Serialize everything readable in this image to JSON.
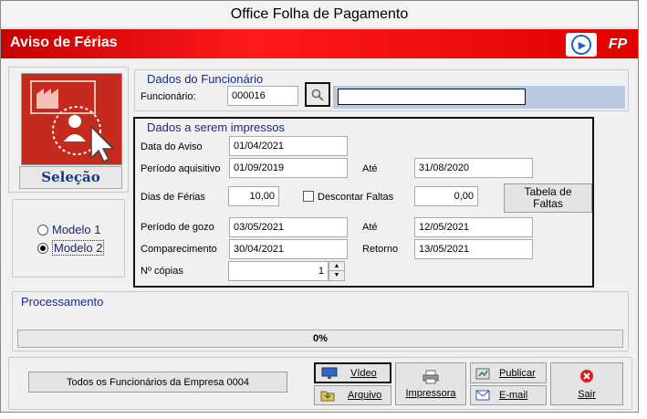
{
  "window": {
    "title": "Office Folha de Pagamento"
  },
  "header": {
    "title": "Aviso de Férias",
    "logo_text": "FP"
  },
  "left": {
    "selecao_label": "Seleção",
    "modelo1": "Modelo 1",
    "modelo2": "Modelo 2",
    "selected": "Modelo 2"
  },
  "funcionario": {
    "group_title": "Dados do Funcionário",
    "label": "Funcionário:",
    "code": "000016",
    "name": ""
  },
  "impressos": {
    "group_title": "Dados a serem impressos",
    "data_aviso_label": "Data do Aviso",
    "data_aviso": "01/04/2021",
    "periodo_aquisitivo_label": "Período aquisitivo",
    "periodo_aquisitivo_inicio": "01/09/2019",
    "ate1_label": "Até",
    "periodo_aquisitivo_fim": "31/08/2020",
    "dias_ferias_label": "Dias de Férias",
    "dias_ferias": "10,00",
    "descontar_faltas_label": "Descontar Faltas",
    "descontar_faltas_checked": false,
    "faltas": "0,00",
    "tabela_faltas_label": "Tabela de Faltas",
    "periodo_gozo_label": "Período de gozo",
    "periodo_gozo_inicio": "03/05/2021",
    "ate2_label": "Até",
    "periodo_gozo_fim": "12/05/2021",
    "comparecimento_label": "Comparecimento",
    "comparecimento": "30/04/2021",
    "retorno_label": "Retorno",
    "retorno": "13/05/2021",
    "copias_label": "Nº cópias",
    "copias": "1"
  },
  "processamento": {
    "title": "Processamento",
    "progress_text": "0%",
    "progress": 0
  },
  "footer": {
    "todos_label": "Todos os Funcionários da Empresa 0004",
    "video": "Vídeo",
    "arquivo": "Arquivo",
    "impressora": "Impressora",
    "publicar": "Publicar",
    "email": "E-mail",
    "sair": "Sair"
  },
  "colors": {
    "header_red": "#e00000",
    "group_title": "#1a2a8a",
    "strip_blue": "#b9c9df"
  }
}
